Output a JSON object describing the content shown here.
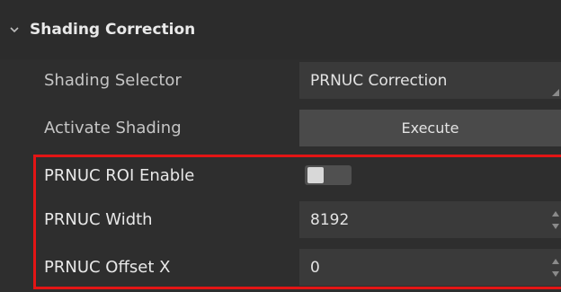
{
  "section": {
    "title": "Shading Correction",
    "expanded": true,
    "chevron_icon": "chevron-down-icon"
  },
  "rows": {
    "shading_selector": {
      "label": "Shading Selector",
      "value": "PRNUC Correction"
    },
    "activate_shading": {
      "label": "Activate Shading",
      "button": "Execute"
    },
    "prnuc_roi_enable": {
      "label": "PRNUC ROI Enable",
      "checked": false
    },
    "prnuc_width": {
      "label": "PRNUC Width",
      "value": "8192"
    },
    "prnuc_offset_x": {
      "label": "PRNUC Offset X",
      "value": "0"
    }
  },
  "colors": {
    "background": "#2e2e2e",
    "field": "#3a3a3a",
    "button": "#4a4a4a",
    "highlight": "#e31515"
  }
}
